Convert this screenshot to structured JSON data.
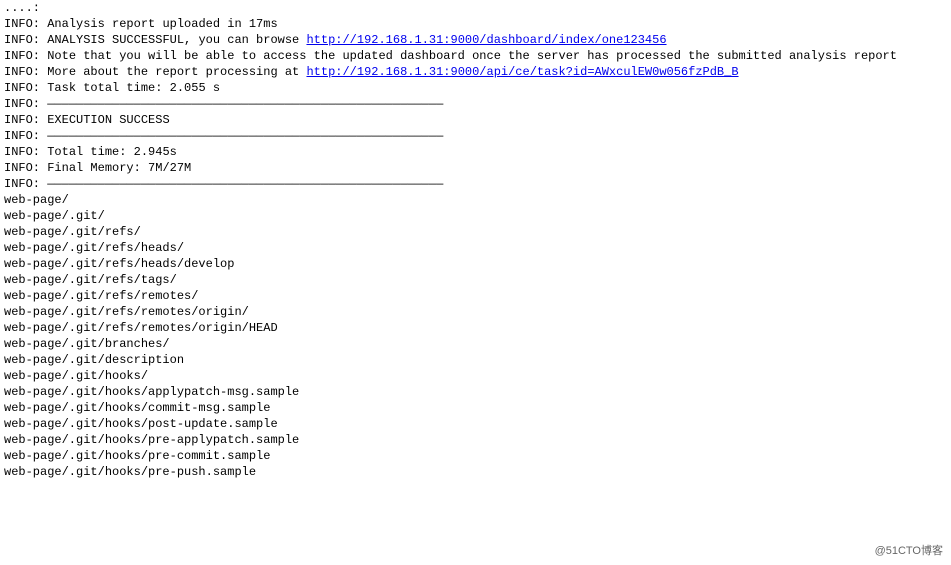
{
  "prefix": "INFO:",
  "lines": {
    "l0": "",
    "l1": "Analysis report uploaded in 17ms",
    "l2a": "ANALYSIS SUCCESSFUL, you can browse ",
    "l2b": "http://192.168.1.31:9000/dashboard/index/one123456",
    "l3": "Note that you will be able to access the updated dashboard once the server has processed the submitted analysis report",
    "l4a": "More about the report processing at ",
    "l4b": "http://192.168.1.31:9000/api/ce/task?id=AWxculEW0w056fzPdB_B",
    "l5": "Task total time: 2.055 s",
    "hr": "———————————————————————————————————————————————————————",
    "exec": "EXECUTION SUCCESS",
    "total": "Total time: 2.945s",
    "mem": "Final Memory: 7M/27M"
  },
  "files": [
    "web-page/",
    "web-page/.git/",
    "web-page/.git/refs/",
    "web-page/.git/refs/heads/",
    "web-page/.git/refs/heads/develop",
    "web-page/.git/refs/tags/",
    "web-page/.git/refs/remotes/",
    "web-page/.git/refs/remotes/origin/",
    "web-page/.git/refs/remotes/origin/HEAD",
    "web-page/.git/branches/",
    "web-page/.git/description",
    "web-page/.git/hooks/",
    "web-page/.git/hooks/applypatch-msg.sample",
    "web-page/.git/hooks/commit-msg.sample",
    "web-page/.git/hooks/post-update.sample",
    "web-page/.git/hooks/pre-applypatch.sample",
    "web-page/.git/hooks/pre-commit.sample",
    "web-page/.git/hooks/pre-push.sample"
  ],
  "watermark": "@51CTO博客"
}
